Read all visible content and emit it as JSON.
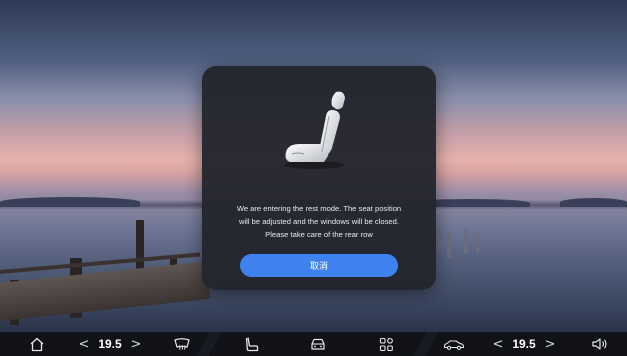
{
  "dialog": {
    "message_lines": [
      "We are entering the rest mode. The seat position",
      "will be adjusted and the windows will be closed.",
      "Please take care of the rear row"
    ],
    "cancel_label": "取消",
    "illustration_icon": "seat-icon"
  },
  "dock": {
    "home_icon": "home-icon",
    "left_temp": "19.5",
    "right_temp": "19.5",
    "left_dec_symbol": "<",
    "left_inc_symbol": ">",
    "right_dec_symbol": "<",
    "right_inc_symbol": ">",
    "icons": [
      "windshield-defrost-icon",
      "seat-icon",
      "car-front-icon",
      "apps-grid-icon",
      "car-side-icon",
      "volume-icon"
    ]
  },
  "colors": {
    "accent": "#3d82ee",
    "dialog_bg": "#24262e",
    "dock_bg": "#101218"
  }
}
